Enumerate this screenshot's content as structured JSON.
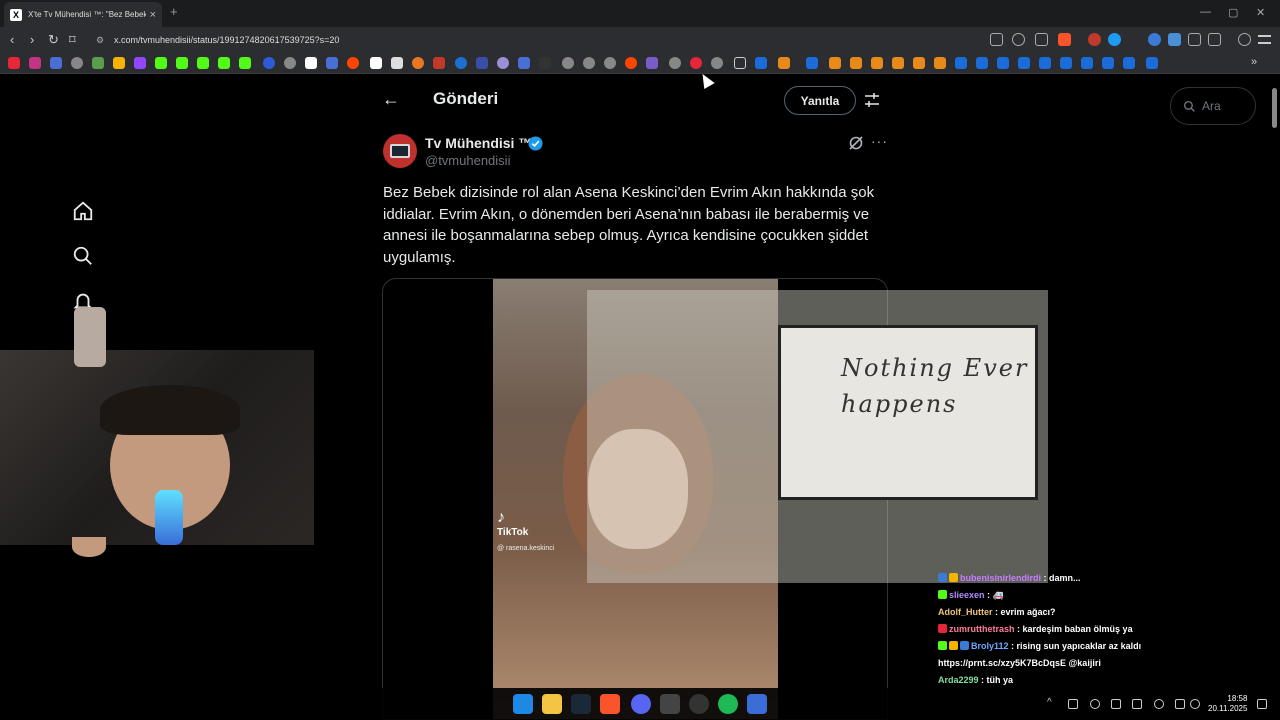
{
  "browser": {
    "tab_title": "X'te Tv Mühendisi ™: \"Bez Bebek",
    "tab_close": "×",
    "new_tab": "+",
    "url": "x.com/tvmuhendisii/status/1991274820617539725?s=20"
  },
  "header": {
    "back_glyph": "←",
    "title": "Gönderi",
    "reply_button": "Yanıtla"
  },
  "search": {
    "placeholder": "Ara"
  },
  "post": {
    "author_name": "Tv Mühendisi ™",
    "author_handle": "@tvmuhendisii",
    "more_glyph": "···",
    "text": "Bez Bebek dizisinde rol alan Asena Keskinci’den Evrim Akın hakkında şok iddialar. Evrim Akın, o dönemden beri Asena’nın babası ile berabermiş ve annesi ile boşanmalarına sebep olmuş. Ayrıca kendisine çocukken şiddet uygulamış.",
    "video_brand": "TikTok",
    "video_user": "@ rasena.keskinci"
  },
  "overlay_art": {
    "text": "Nothing Ever happens"
  },
  "chat": {
    "messages": [
      {
        "user": "bubenisinirlendirdi",
        "text": ": damn...",
        "color": "#c77dff"
      },
      {
        "user": "slieexen",
        "text": ": 🚑",
        "color": "#b388ff"
      },
      {
        "user": "Adolf_Hutter",
        "text": ": evrim ağacı?",
        "color": "#f0c080"
      },
      {
        "user": "zumrutthetrash",
        "text": ": kardeşim baban ölmüş ya",
        "color": "#ff7b9c"
      },
      {
        "user": "Broly112",
        "text": ": rising sun yapıcaklar az kaldı",
        "color": "#6ea8ff"
      },
      {
        "user": "",
        "text": "https://prnt.sc/xzy5K7BcDqsE @kaijiri",
        "color": "#ffffff"
      },
      {
        "user": "Arda2299",
        "text": ": tüh ya",
        "color": "#7fe0a0"
      }
    ]
  },
  "taskbar": {
    "time": "18:58",
    "date": "20.11.2025"
  },
  "colors": {
    "accent": "#1d9bf0",
    "background": "#000000",
    "secondary_text": "#71767b"
  }
}
